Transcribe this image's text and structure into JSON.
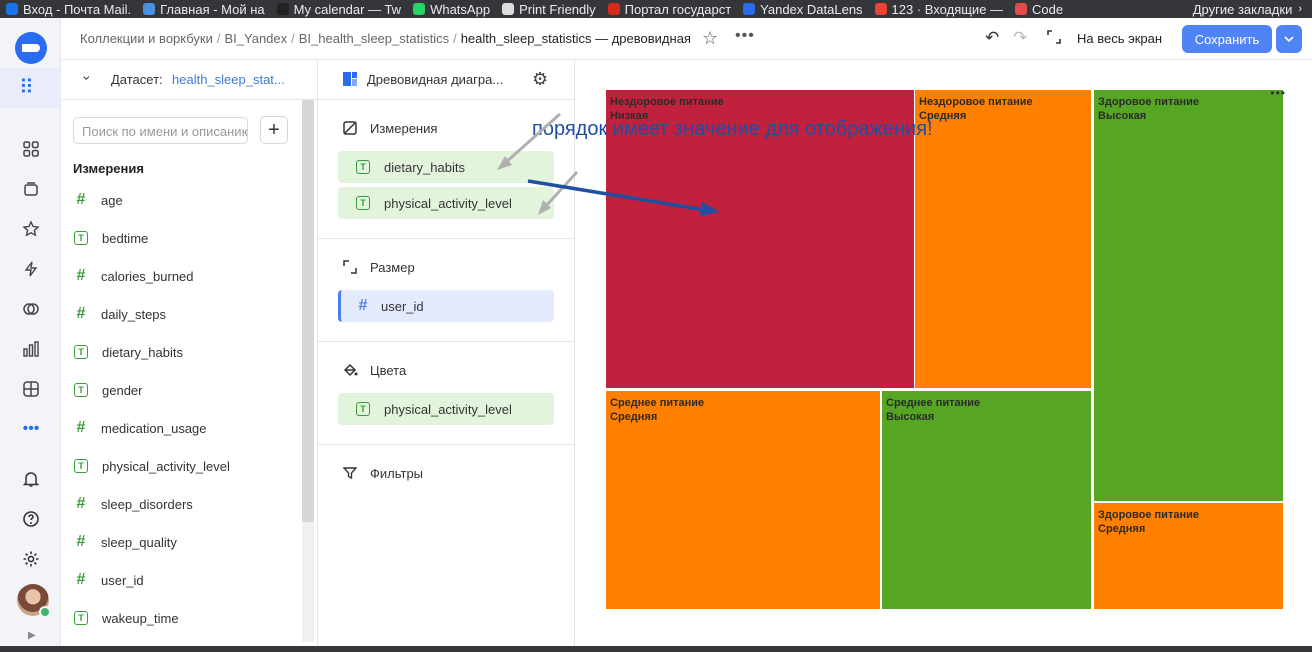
{
  "bookmarks": [
    {
      "label": "Вход - Почта Mail.",
      "color": "#1a73e8"
    },
    {
      "label": "Главная - Мой на",
      "color": "#4a90e2"
    },
    {
      "label": "My calendar — Tw",
      "color": "#222222"
    },
    {
      "label": "WhatsApp",
      "color": "#25d366"
    },
    {
      "label": "Print Friendly",
      "color": "#dddddd"
    },
    {
      "label": "Портал государст",
      "color": "#d52b1e"
    },
    {
      "label": "Yandex DataLens",
      "color": "#2a6cf0"
    },
    {
      "label": "123 · Входящие —",
      "color": "#ea4335"
    },
    {
      "label": "Code",
      "color": "#e34c4c"
    }
  ],
  "bookmarks_other": "Другие закладки",
  "header": {
    "breadcrumbs": [
      "Коллекции и воркбуки",
      "BI_Yandex",
      "BI_health_sleep_statistics"
    ],
    "current": "health_sleep_statistics — древовидная",
    "fullscreen": "На весь экран",
    "save": "Сохранить"
  },
  "dataset": {
    "label": "Датасет:",
    "name": "health_sleep_stat...",
    "search_placeholder": "Поиск по имени и описанию",
    "fields_title": "Измерения",
    "fields": [
      {
        "name": "age",
        "type": "number"
      },
      {
        "name": "bedtime",
        "type": "text"
      },
      {
        "name": "calories_burned",
        "type": "number"
      },
      {
        "name": "daily_steps",
        "type": "number"
      },
      {
        "name": "dietary_habits",
        "type": "text"
      },
      {
        "name": "gender",
        "type": "text"
      },
      {
        "name": "medication_usage",
        "type": "number"
      },
      {
        "name": "physical_activity_level",
        "type": "text"
      },
      {
        "name": "sleep_disorders",
        "type": "number"
      },
      {
        "name": "sleep_quality",
        "type": "number"
      },
      {
        "name": "user_id",
        "type": "number"
      },
      {
        "name": "wakeup_time",
        "type": "text"
      }
    ]
  },
  "wizard": {
    "chart_type": "Древовидная диагра...",
    "sections": {
      "dimensions": {
        "title": "Измерения",
        "items": [
          "dietary_habits",
          "physical_activity_level"
        ]
      },
      "size": {
        "title": "Размер",
        "items": [
          "user_id"
        ]
      },
      "colors": {
        "title": "Цвета",
        "items": [
          "physical_activity_level"
        ]
      },
      "filters": {
        "title": "Фильтры"
      }
    }
  },
  "annotation": "порядок имеет значение для отображения!",
  "colors": {
    "low": "#c2213e",
    "medium": "#ff7f00",
    "high": "#56a624"
  },
  "chart_data": {
    "type": "treemap",
    "dimensions": [
      "dietary_habits",
      "physical_activity_level"
    ],
    "size_field": "user_id",
    "color_field": "physical_activity_level",
    "tiles": [
      {
        "dietary_habits": "Нездоровое питание",
        "activity": "Низкая",
        "color_key": "low"
      },
      {
        "dietary_habits": "Нездоровое питание",
        "activity": "Средняя",
        "color_key": "medium"
      },
      {
        "dietary_habits": "Среднее питание",
        "activity": "Средняя",
        "color_key": "medium"
      },
      {
        "dietary_habits": "Среднее питание",
        "activity": "Высокая",
        "color_key": "high"
      },
      {
        "dietary_habits": "Здоровое питание",
        "activity": "Высокая",
        "color_key": "high"
      },
      {
        "dietary_habits": "Здоровое питание",
        "activity": "Средняя",
        "color_key": "medium"
      }
    ]
  }
}
